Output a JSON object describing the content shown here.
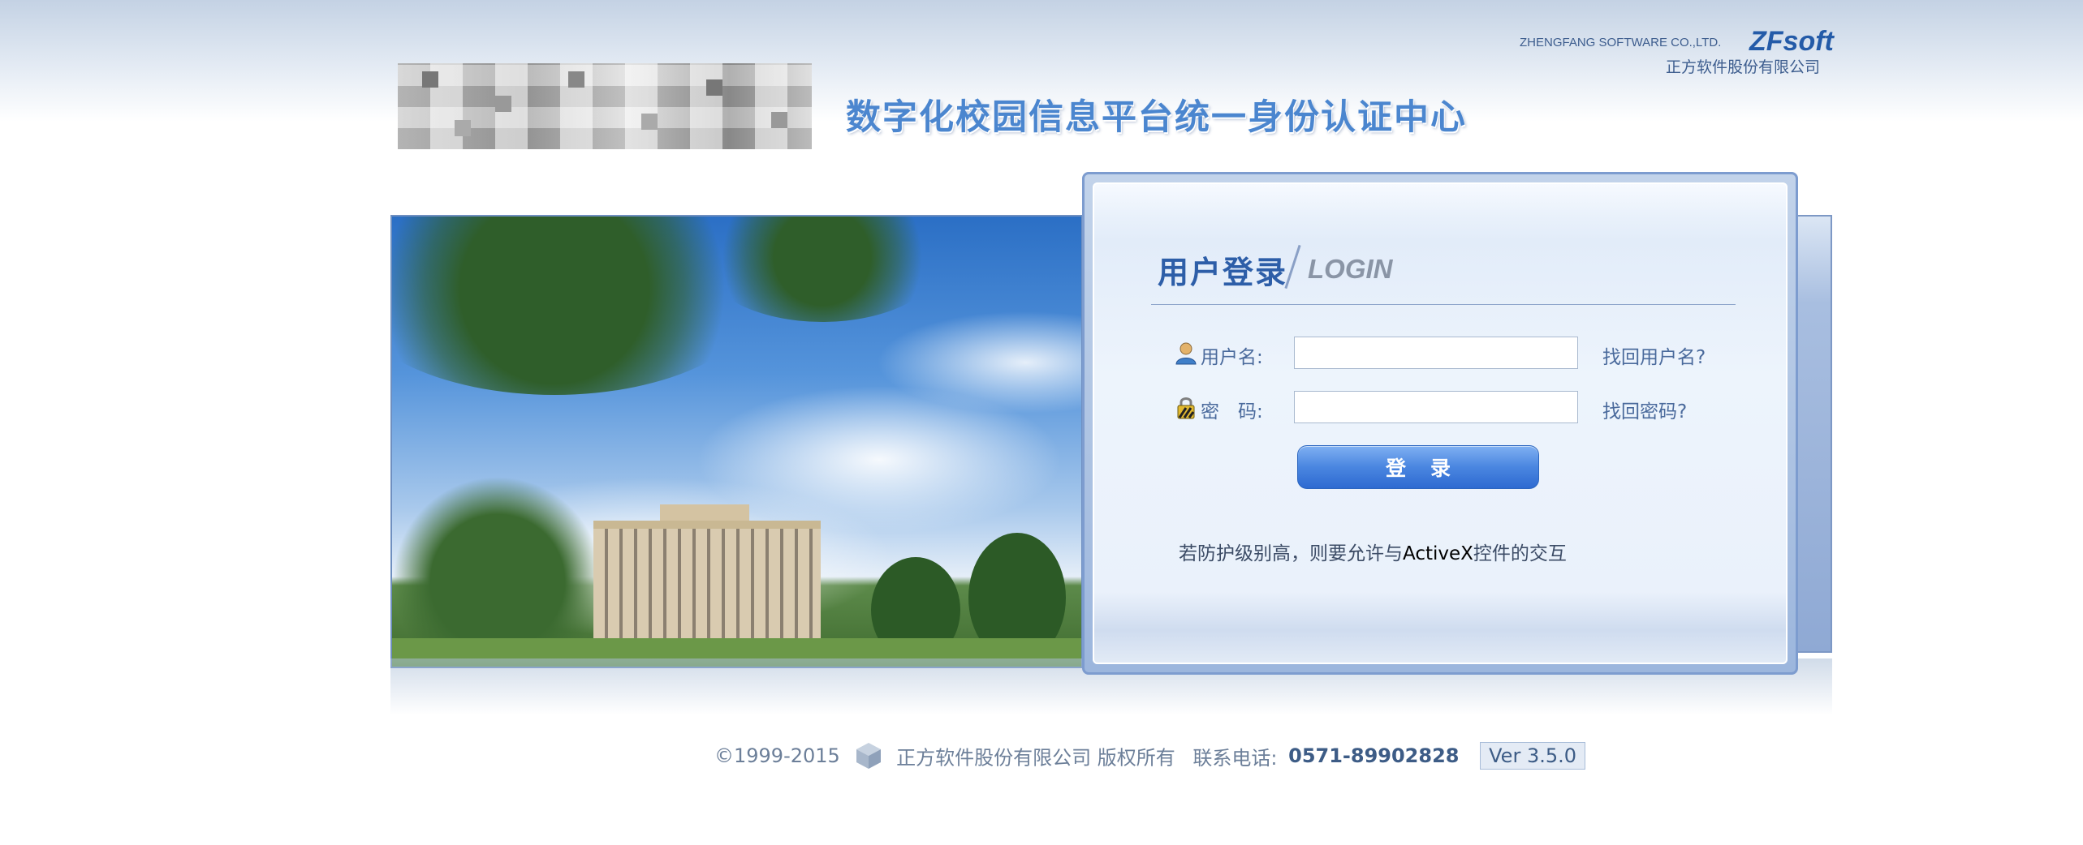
{
  "header": {
    "platform_title": "数字化校园信息平台统一身份认证中心",
    "company_en": "ZHENGFANG SOFTWARE CO.,LTD.",
    "brand": "ZFsoft",
    "company_cn": "正方软件股份有限公司"
  },
  "login": {
    "title": "用户登录",
    "subtitle": "LOGIN",
    "username_label": "用户名:",
    "username_value": "",
    "username_link": "找回用户名?",
    "password_label": "密　码:",
    "password_value": "",
    "password_link": "找回密码?",
    "submit_label": "登录",
    "note_prefix": "若防护级别高，则要允许与",
    "note_highlight": "ActiveX",
    "note_suffix": "控件的交互"
  },
  "footer": {
    "copyright": "©1999-2015",
    "company": "正方软件股份有限公司 版权所有",
    "contact_label": "联系电话:",
    "phone": "0571-89902828",
    "version": "Ver 3.5.0"
  },
  "icons": {
    "user": "user-icon",
    "lock": "lock-icon",
    "logo": "cube-logo-icon"
  }
}
